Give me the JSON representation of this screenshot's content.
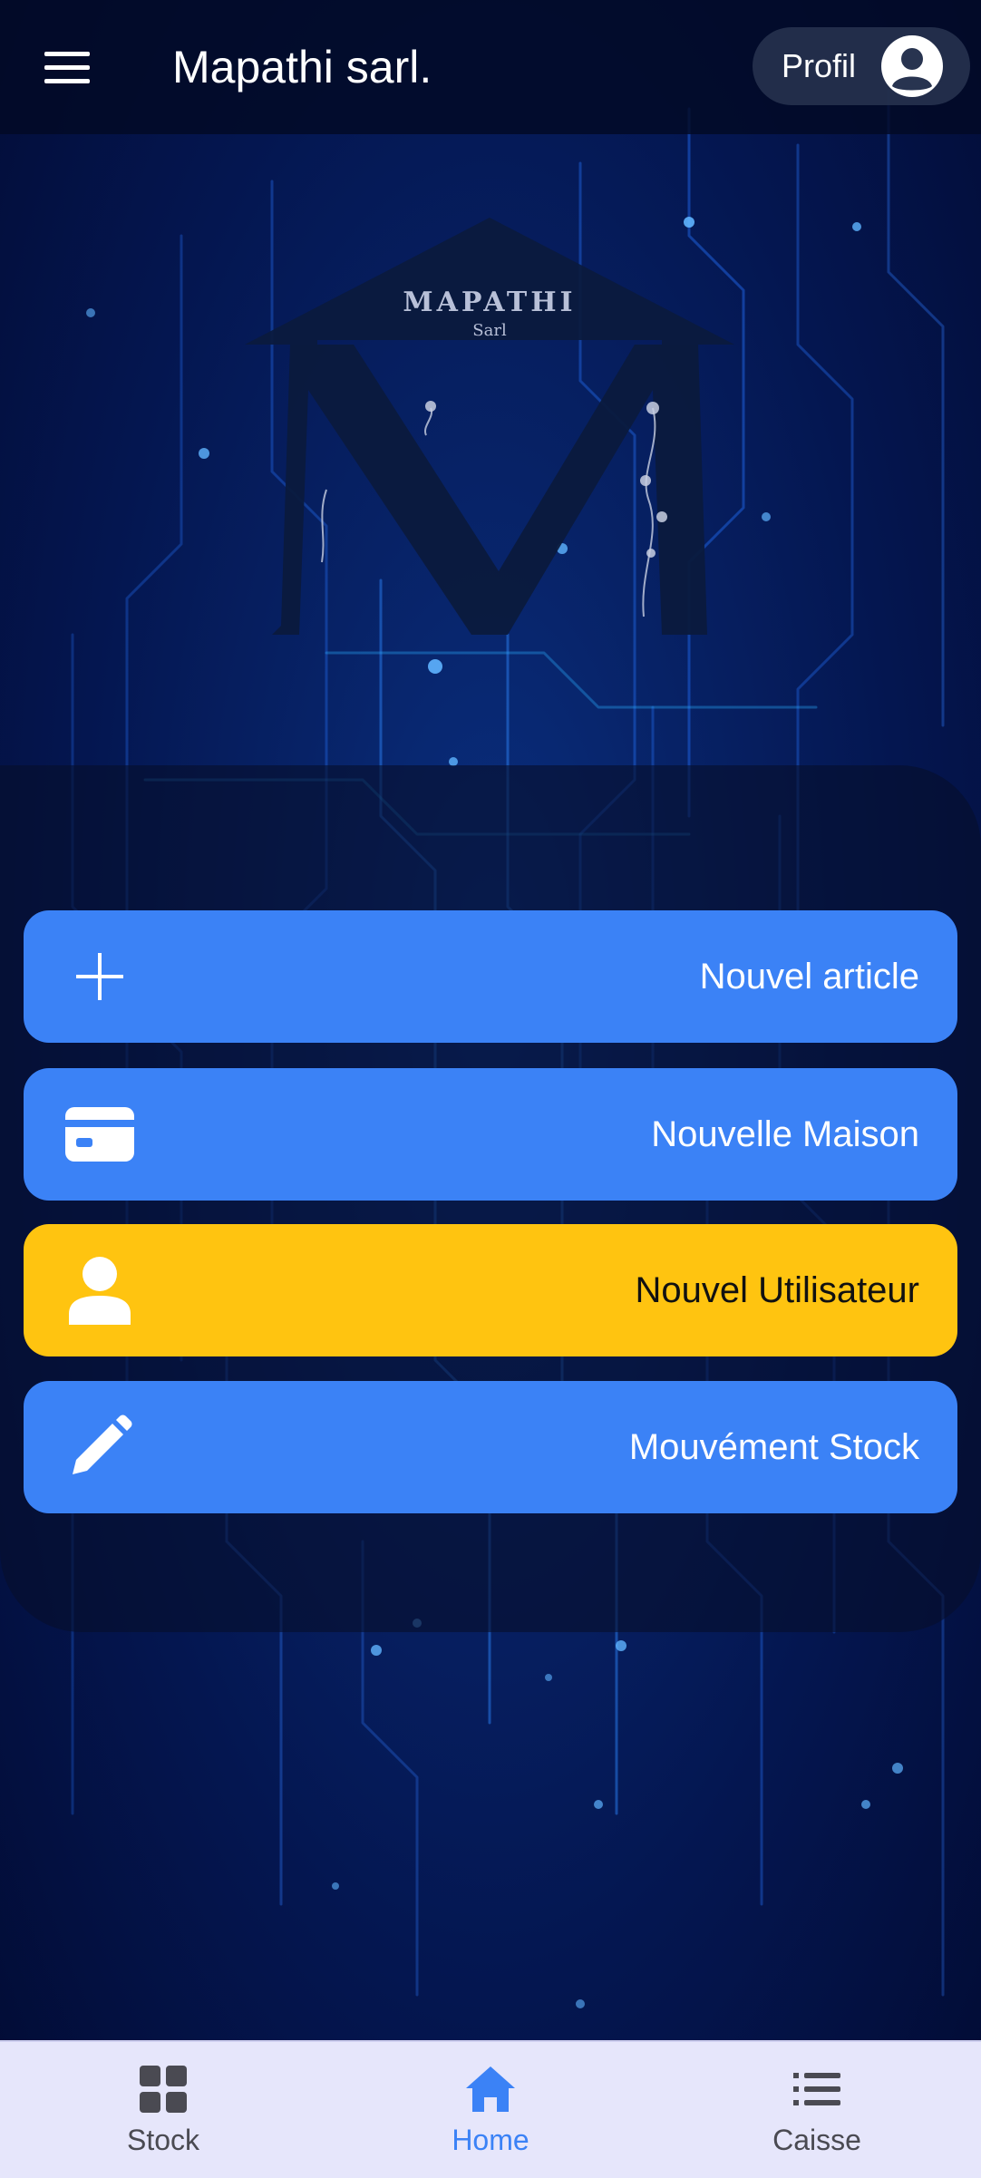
{
  "header": {
    "title": "Mapathi sarl.",
    "menu_icon": "hamburger-menu-icon",
    "profile_label": "Profil",
    "profile_icon": "user-avatar-icon"
  },
  "logo": {
    "brand": "MAPATHI",
    "sub": "Sarl"
  },
  "actions": [
    {
      "label": "Nouvel article",
      "icon": "plus-icon",
      "color": "#3b82f6"
    },
    {
      "label": "Nouvelle Maison",
      "icon": "card-icon",
      "color": "#3b82f6"
    },
    {
      "label": "Nouvel Utilisateur",
      "icon": "person-icon",
      "color": "#ffc410"
    },
    {
      "label": "Mouvément Stock",
      "icon": "pencil-icon",
      "color": "#3b82f6"
    }
  ],
  "bottom_nav": {
    "items": [
      {
        "label": "Stock",
        "icon": "grid-icon",
        "active": false
      },
      {
        "label": "Home",
        "icon": "home-icon",
        "active": true
      },
      {
        "label": "Caisse",
        "icon": "list-icon",
        "active": false
      }
    ],
    "active_color": "#3b82f6",
    "inactive_color": "#4a4a52"
  },
  "theme": {
    "accent_blue": "#3b82f6",
    "accent_yellow": "#ffc410",
    "background": "#041650"
  }
}
